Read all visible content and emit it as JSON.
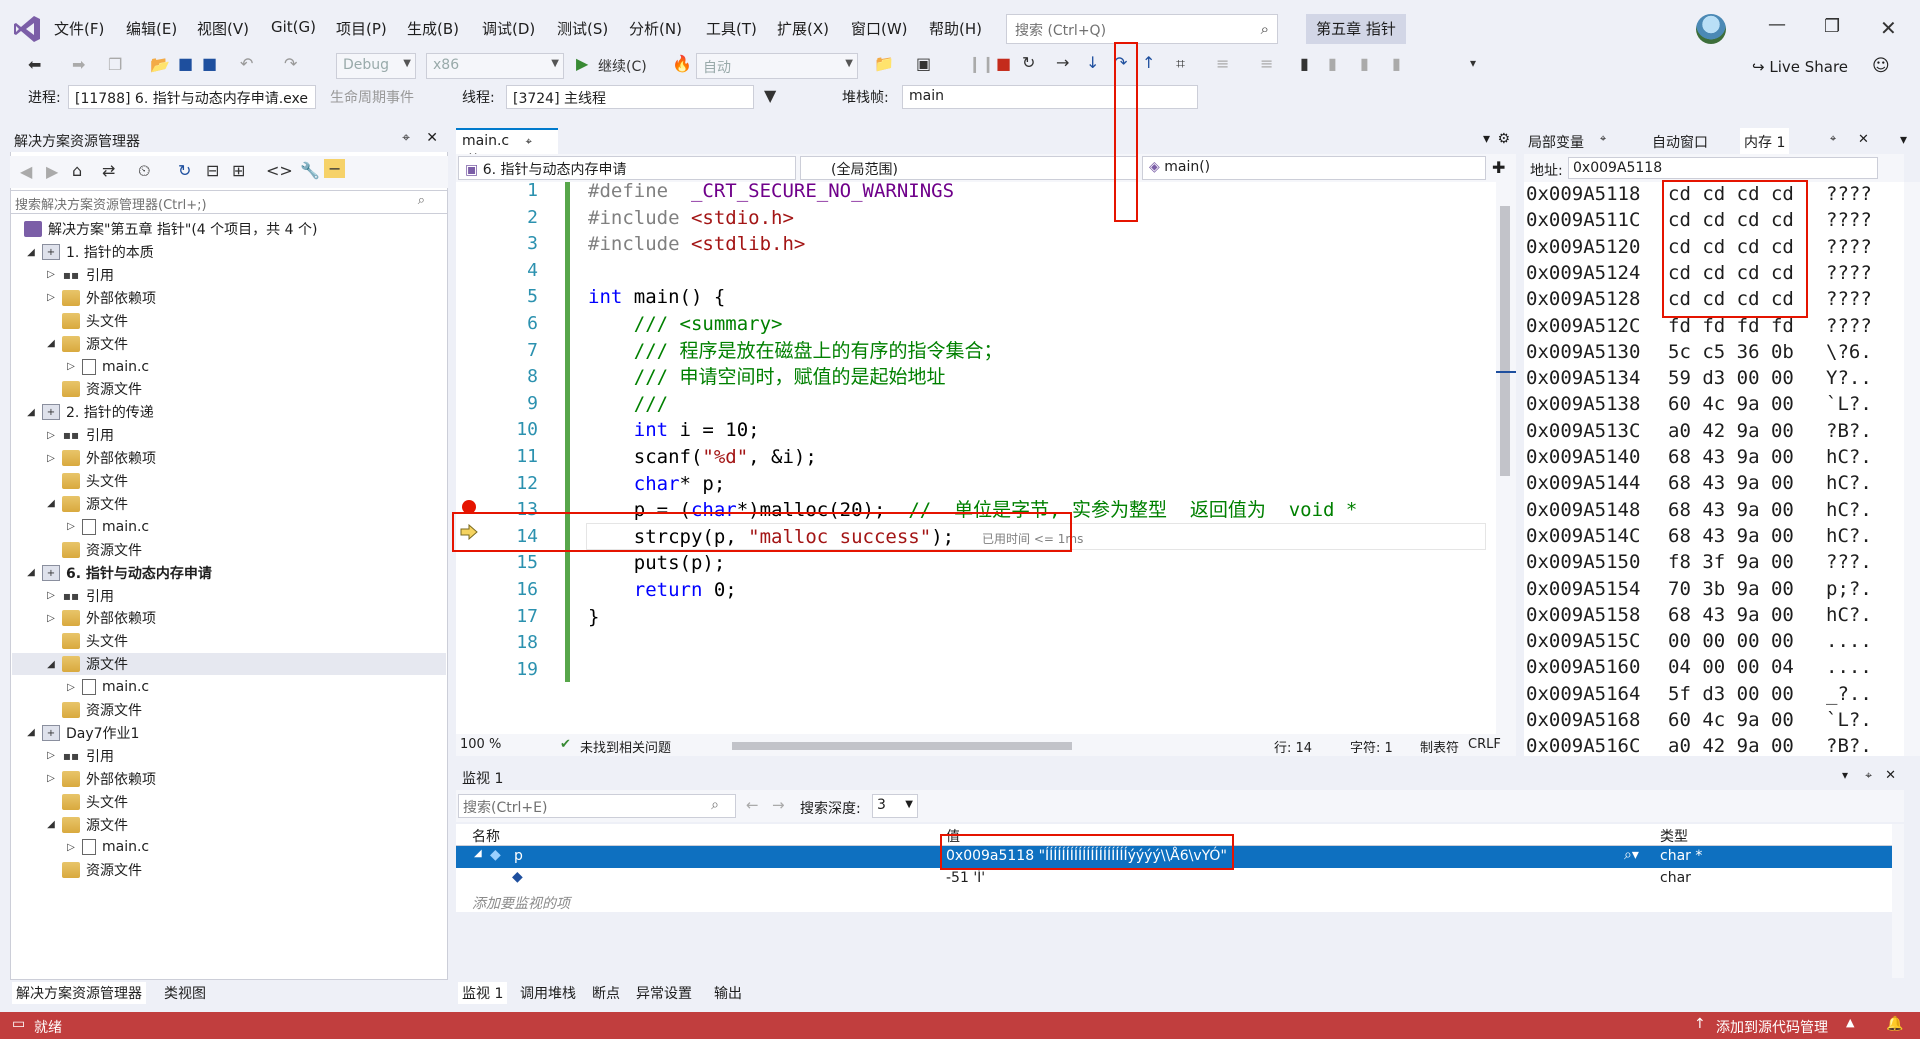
{
  "window": {
    "menu": [
      "文件(F)",
      "编辑(E)",
      "视图(V)",
      "Git(G)",
      "项目(P)",
      "生成(B)",
      "调试(D)",
      "测试(S)",
      "分析(N)",
      "工具(T)",
      "扩展(X)",
      "窗口(W)",
      "帮助(H)"
    ],
    "search_placeholder": "搜索 (Ctrl+Q)",
    "solution_name": "第五章 指针",
    "live_share": "Live Share"
  },
  "toolbar": {
    "config": "Debug",
    "platform": "x86",
    "continue": "继续(C)",
    "auto": "自动"
  },
  "debug_bar": {
    "process_label": "进程:",
    "process": "[11788] 6. 指针与动态内存申请.exe",
    "lifecycle": "生命周期事件",
    "thread_label": "线程:",
    "thread": "[3724] 主线程",
    "stackframe_label": "堆栈帧:",
    "stackframe": "main"
  },
  "solution_explorer": {
    "title": "解决方案资源管理器",
    "search_placeholder": "搜索解决方案资源管理器(Ctrl+;)",
    "root": "解决方案\"第五章 指针\"(4 个项目，共 4 个)",
    "items": [
      {
        "label": "1. 指针的本质",
        "type": "project",
        "indent": 1,
        "bold": false
      },
      {
        "label": "引用",
        "type": "ref",
        "indent": 2
      },
      {
        "label": "外部依赖项",
        "type": "folder",
        "indent": 2
      },
      {
        "label": "头文件",
        "type": "folder",
        "indent": 2
      },
      {
        "label": "源文件",
        "type": "folder",
        "indent": 2
      },
      {
        "label": "main.c",
        "type": "file",
        "indent": 3
      },
      {
        "label": "资源文件",
        "type": "folder",
        "indent": 2
      },
      {
        "label": "2. 指针的传递",
        "type": "project",
        "indent": 1
      },
      {
        "label": "引用",
        "type": "ref",
        "indent": 2
      },
      {
        "label": "外部依赖项",
        "type": "folder",
        "indent": 2
      },
      {
        "label": "头文件",
        "type": "folder",
        "indent": 2
      },
      {
        "label": "源文件",
        "type": "folder",
        "indent": 2
      },
      {
        "label": "main.c",
        "type": "file",
        "indent": 3
      },
      {
        "label": "资源文件",
        "type": "folder",
        "indent": 2
      },
      {
        "label": "6. 指针与动态内存申请",
        "type": "project",
        "indent": 1
      },
      {
        "label": "引用",
        "type": "ref",
        "indent": 2
      },
      {
        "label": "外部依赖项",
        "type": "folder",
        "indent": 2
      },
      {
        "label": "头文件",
        "type": "folder",
        "indent": 2
      },
      {
        "label": "源文件",
        "type": "folder",
        "indent": 2
      },
      {
        "label": "main.c",
        "type": "file",
        "indent": 3
      },
      {
        "label": "资源文件",
        "type": "folder",
        "indent": 2
      },
      {
        "label": "Day7作业1",
        "type": "project",
        "indent": 1
      },
      {
        "label": "引用",
        "type": "ref",
        "indent": 2
      },
      {
        "label": "外部依赖项",
        "type": "folder",
        "indent": 2
      },
      {
        "label": "头文件",
        "type": "folder",
        "indent": 2
      },
      {
        "label": "源文件",
        "type": "folder",
        "indent": 2
      },
      {
        "label": "main.c",
        "type": "file",
        "indent": 3
      },
      {
        "label": "资源文件",
        "type": "folder",
        "indent": 2
      }
    ],
    "tabs": [
      "解决方案资源管理器",
      "类视图"
    ]
  },
  "editor": {
    "tab": "main.c",
    "nav_project": "6. 指针与动态内存申请",
    "nav_scope": "(全局范围)",
    "nav_function": "main()",
    "elapsed": "已用时间 <= 1ms",
    "status": {
      "zoom": "100 %",
      "issues": "未找到相关问题",
      "line": "行: 14",
      "col": "字符: 1",
      "tabs": "制表符",
      "eol": "CRLF"
    }
  },
  "memory": {
    "tabs": [
      "局部变量",
      "自动窗口",
      "内存 1"
    ],
    "address_label": "地址:",
    "address": "0x009A5118",
    "rows": [
      {
        "addr": "0x009A5118",
        "bytes": "cd cd cd cd",
        "ascii": "????"
      },
      {
        "addr": "0x009A511C",
        "bytes": "cd cd cd cd",
        "ascii": "????"
      },
      {
        "addr": "0x009A5120",
        "bytes": "cd cd cd cd",
        "ascii": "????"
      },
      {
        "addr": "0x009A5124",
        "bytes": "cd cd cd cd",
        "ascii": "????"
      },
      {
        "addr": "0x009A5128",
        "bytes": "cd cd cd cd",
        "ascii": "????"
      },
      {
        "addr": "0x009A512C",
        "bytes": "fd fd fd fd",
        "ascii": "????"
      },
      {
        "addr": "0x009A5130",
        "bytes": "5c c5 36 0b",
        "ascii": "\\?6."
      },
      {
        "addr": "0x009A5134",
        "bytes": "59 d3 00 00",
        "ascii": "Y?.."
      },
      {
        "addr": "0x009A5138",
        "bytes": "60 4c 9a 00",
        "ascii": "`L?."
      },
      {
        "addr": "0x009A513C",
        "bytes": "a0 42 9a 00",
        "ascii": "?B?."
      },
      {
        "addr": "0x009A5140",
        "bytes": "68 43 9a 00",
        "ascii": "hC?."
      },
      {
        "addr": "0x009A5144",
        "bytes": "68 43 9a 00",
        "ascii": "hC?."
      },
      {
        "addr": "0x009A5148",
        "bytes": "68 43 9a 00",
        "ascii": "hC?."
      },
      {
        "addr": "0x009A514C",
        "bytes": "68 43 9a 00",
        "ascii": "hC?."
      },
      {
        "addr": "0x009A5150",
        "bytes": "f8 3f 9a 00",
        "ascii": "???."
      },
      {
        "addr": "0x009A5154",
        "bytes": "70 3b 9a 00",
        "ascii": "p;?."
      },
      {
        "addr": "0x009A5158",
        "bytes": "68 43 9a 00",
        "ascii": "hC?."
      },
      {
        "addr": "0x009A515C",
        "bytes": "00 00 00 00",
        "ascii": "...."
      },
      {
        "addr": "0x009A5160",
        "bytes": "04 00 00 04",
        "ascii": "...."
      },
      {
        "addr": "0x009A5164",
        "bytes": "5f d3 00 00",
        "ascii": "_?.."
      },
      {
        "addr": "0x009A5168",
        "bytes": "60 4c 9a 00",
        "ascii": "`L?."
      },
      {
        "addr": "0x009A516C",
        "bytes": "a0 42 9a 00",
        "ascii": "?B?."
      }
    ]
  },
  "watch": {
    "title": "监视 1",
    "search_placeholder": "搜索(Ctrl+E)",
    "depth_label": "搜索深度:",
    "depth": "3",
    "columns": [
      "名称",
      "值",
      "类型"
    ],
    "rows": [
      {
        "name": "p",
        "value": "0x009a5118 \"ÍÍÍÍÍÍÍÍÍÍÍÍÍÍÍÍÍÍÍÍýýýý\\\\Å6\\vYÓ\"",
        "type": "char *"
      },
      {
        "name": "",
        "value": "-51 'Í'",
        "type": "char"
      }
    ],
    "add_placeholder": "添加要监视的项",
    "tabs": [
      "监视 1",
      "调用堆栈",
      "断点",
      "异常设置",
      "输出"
    ]
  },
  "statusbar": {
    "ready": "就绪",
    "add_source": "添加到源代码管理"
  },
  "colors": {
    "status_bar": "#c13e3e",
    "selection": "#0e70c0",
    "highlight_box": "#e51400"
  }
}
